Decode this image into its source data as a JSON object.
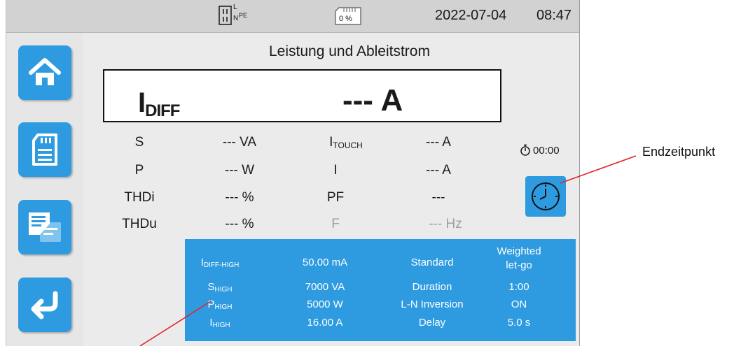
{
  "status_bar": {
    "plug_label_l": "L",
    "plug_label_n": "N",
    "plug_label_pe": "PE",
    "storage_percent": "0 %",
    "date": "2022-07-04",
    "time": "08:47"
  },
  "sidebar": {
    "items": [
      {
        "name": "home",
        "icon": "house-icon"
      },
      {
        "name": "memory",
        "icon": "sd-card-icon"
      },
      {
        "name": "report",
        "icon": "document-icon"
      },
      {
        "name": "back",
        "icon": "return-arrow-icon"
      }
    ]
  },
  "main": {
    "title": "Leistung und Ableitstrom",
    "primary": {
      "label_main": "I",
      "label_sub": "DIFF",
      "value": "--- A"
    },
    "measurements": [
      {
        "label": "S",
        "value": "--- VA"
      },
      {
        "label": "P",
        "value": "--- W"
      },
      {
        "label": "THDi",
        "value": "--- %"
      },
      {
        "label": "THDu",
        "value": "--- %"
      }
    ],
    "measurements_right": [
      {
        "label_main": "I",
        "label_sub": "TOUCH",
        "value": "--- A"
      },
      {
        "label_main": "I",
        "label_sub": "",
        "value": "--- A"
      },
      {
        "label_main": "PF",
        "label_sub": "",
        "value": "---"
      },
      {
        "label_main": "F",
        "label_sub": "",
        "value": "--- Hz"
      }
    ],
    "timer": "00:00"
  },
  "parameters": {
    "rows": [
      {
        "k_main": "I",
        "k_sub": "DIFF-HIGH",
        "v": "50.00 mA",
        "k2": "Standard",
        "v2_line1": "Weighted",
        "v2_line2": "let-go"
      },
      {
        "k_main": "S",
        "k_sub": "HIGH",
        "v": "7000 VA",
        "k2": "Duration",
        "v2_line1": "1:00",
        "v2_line2": ""
      },
      {
        "k_main": "P",
        "k_sub": "HIGH",
        "v": "5000 W",
        "k2": "L-N Inversion",
        "v2_line1": "ON",
        "v2_line2": ""
      },
      {
        "k_main": "I",
        "k_sub": "HIGH",
        "v": "16.00 A",
        "k2": "Delay",
        "v2_line1": "5.0 s",
        "v2_line2": ""
      }
    ]
  },
  "callouts": {
    "end_time": "Endzeitpunkt"
  },
  "colors": {
    "accent": "#2e9be0",
    "callout_line": "#e0242a"
  }
}
